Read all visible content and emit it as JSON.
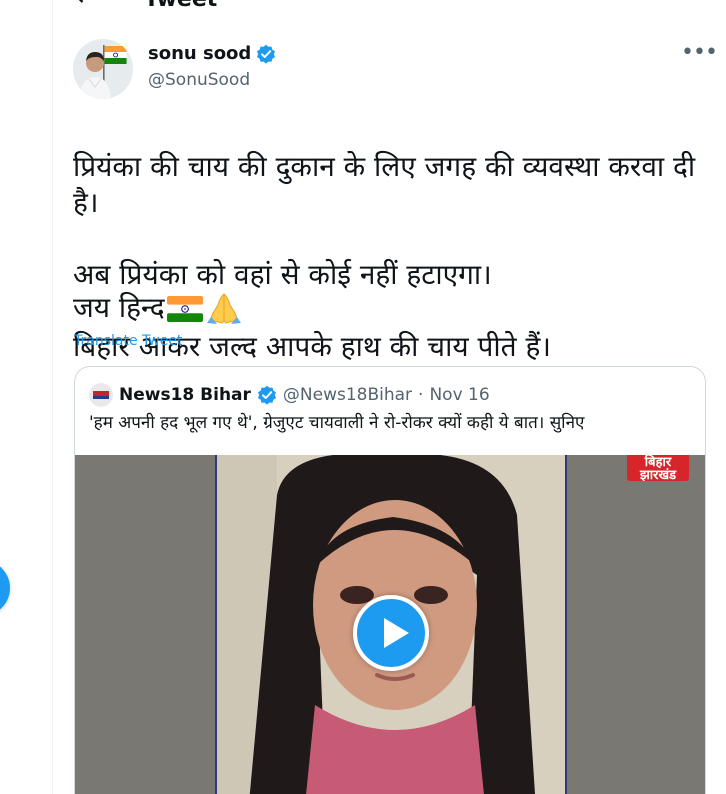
{
  "header": {
    "back_icon": "back-arrow-icon",
    "title": "Tweet"
  },
  "author": {
    "name": "sonu sood",
    "handle": "@SonuSood",
    "verified_icon": "verified-badge-icon"
  },
  "tweet": {
    "text_lines": [
      "प्रियंका की चाय की दुकान के लिए जगह की व्यवस्था करवा दी है।",
      "अब प्रियंका को वहां से कोई नहीं हटाएगा।",
      "बिहार आकर जल्द आपके हाथ की चाय पीते हैं।"
    ],
    "sign_off": "जय हिन्द",
    "emojis": [
      "flag-india-icon",
      "folded-hands-icon"
    ],
    "translate_label": "Translate Tweet"
  },
  "quoted": {
    "name": "News18 Bihar",
    "handle": "@News18Bihar",
    "separator": "·",
    "date": "Nov 16",
    "text": "'हम अपनी हद भूल गए थे', ग्रेजुएट चायवाली ने रो-रोकर क्यों कही ये बात। सुनिए",
    "media": {
      "channel_badge_line1": "बिहार",
      "channel_badge_line2": "झारखंड",
      "play_icon": "play-icon"
    }
  },
  "colors": {
    "accent": "#1d9bf0",
    "text": "#0f1419",
    "secondary_text": "#536471",
    "border": "#cfd9de",
    "badge_red": "#d7262b"
  }
}
